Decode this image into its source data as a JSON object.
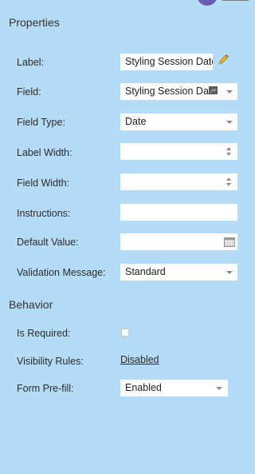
{
  "sections": {
    "properties_title": "Properties",
    "behavior_title": "Behavior"
  },
  "properties": {
    "label": {
      "label": "Label:",
      "value": "Styling Session Date"
    },
    "field": {
      "label": "Field:",
      "value": "Styling Session Date"
    },
    "field_type": {
      "label": "Field Type:",
      "value": "Date"
    },
    "label_width": {
      "label": "Label Width:",
      "value": ""
    },
    "field_width": {
      "label": "Field Width:",
      "value": ""
    },
    "instructions": {
      "label": "Instructions:",
      "value": ""
    },
    "default_value": {
      "label": "Default Value:",
      "value": ""
    },
    "validation_message": {
      "label": "Validation Message:",
      "value": "Standard"
    }
  },
  "behavior": {
    "is_required": {
      "label": "Is Required:",
      "checked": false
    },
    "visibility_rules": {
      "label": "Visibility Rules:",
      "value": "Disabled"
    },
    "form_prefill": {
      "label": "Form Pre-fill:",
      "value": "Enabled"
    }
  },
  "icons": {
    "edit": "pencil-icon",
    "calendar": "calendar-icon",
    "dropdown": "chevron-down-icon",
    "spinner": "spinner-arrows-icon"
  },
  "colors": {
    "panel_bg": "#b5dcf6",
    "field_bg": "#ffffff",
    "pencil": "#d9a21b"
  }
}
